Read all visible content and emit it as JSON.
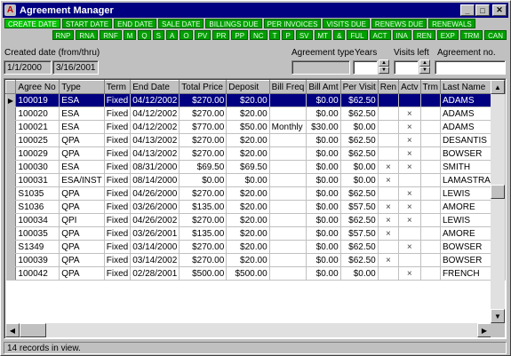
{
  "window": {
    "title": "Agreement Manager",
    "icon_letter": "A"
  },
  "title_buttons": {
    "minimize": "_",
    "maximize": "□",
    "close": "✕"
  },
  "nav_top": [
    "CREATE DATE",
    "START DATE",
    "END DATE",
    "SALE DATE",
    "BILLINGS DUE",
    "PER INVOICES",
    "VISITS DUE",
    "RENEWS DUE",
    "RENEWALS"
  ],
  "nav_bottom": [
    "RNP",
    "RNA",
    "RNF",
    "M",
    "Q",
    "S",
    "A",
    "O",
    "PV",
    "PR",
    "PP",
    "NC",
    "T",
    "P",
    "SV",
    "MT",
    "&",
    "FUL",
    "ACT",
    "INA",
    "REN",
    "EXP",
    "TRM",
    "CAN"
  ],
  "filters": {
    "created_label": "Created date (from/thru)",
    "from": "1/1/2000",
    "thru": "3/16/2001",
    "agreement_type_label": "Agreement type",
    "agreement_type_value": "",
    "years_label": "Years",
    "years_value": "",
    "visits_left_label": "Visits left",
    "visits_left_value": "",
    "agreement_no_label": "Agreement no.",
    "agreement_no_value": ""
  },
  "table": {
    "columns": [
      "Agree No",
      "Type",
      "Term",
      "End Date",
      "Total Price",
      "Deposit",
      "Bill Freq",
      "Bill Amt",
      "Per Visit",
      "Ren",
      "Actv",
      "Trm",
      "Last Name"
    ],
    "rows": [
      [
        "100019",
        "ESA",
        "Fixed",
        "04/12/2002",
        "$270.00",
        "$20.00",
        "",
        "$0.00",
        "$62.50",
        "",
        "",
        "",
        "ADAMS"
      ],
      [
        "100020",
        "ESA",
        "Fixed",
        "04/12/2002",
        "$270.00",
        "$20.00",
        "",
        "$0.00",
        "$62.50",
        "",
        "×",
        "",
        "ADAMS"
      ],
      [
        "100021",
        "ESA",
        "Fixed",
        "04/12/2002",
        "$770.00",
        "$50.00",
        "Monthly",
        "$30.00",
        "$0.00",
        "",
        "×",
        "",
        "ADAMS"
      ],
      [
        "100025",
        "QPA",
        "Fixed",
        "04/13/2002",
        "$270.00",
        "$20.00",
        "",
        "$0.00",
        "$62.50",
        "",
        "×",
        "",
        "DESANTIS"
      ],
      [
        "100029",
        "QPA",
        "Fixed",
        "04/13/2002",
        "$270.00",
        "$20.00",
        "",
        "$0.00",
        "$62.50",
        "",
        "×",
        "",
        "BOWSER"
      ],
      [
        "100030",
        "ESA",
        "Fixed",
        "08/31/2000",
        "$69.50",
        "$69.50",
        "",
        "$0.00",
        "$0.00",
        "×",
        "×",
        "",
        "SMITH"
      ],
      [
        "100031",
        "ESA/INST",
        "Fixed",
        "08/14/2000",
        "$0.00",
        "$0.00",
        "",
        "$0.00",
        "$0.00",
        "×",
        "",
        "",
        "LAMASTRA"
      ],
      [
        "S1035",
        "QPA",
        "Fixed",
        "04/26/2000",
        "$270.00",
        "$20.00",
        "",
        "$0.00",
        "$62.50",
        "",
        "×",
        "",
        "LEWIS"
      ],
      [
        "S1036",
        "QPA",
        "Fixed",
        "03/26/2000",
        "$135.00",
        "$20.00",
        "",
        "$0.00",
        "$57.50",
        "×",
        "×",
        "",
        "AMORE"
      ],
      [
        "100034",
        "QPI",
        "Fixed",
        "04/26/2002",
        "$270.00",
        "$20.00",
        "",
        "$0.00",
        "$62.50",
        "×",
        "×",
        "",
        "LEWIS"
      ],
      [
        "100035",
        "QPA",
        "Fixed",
        "03/26/2001",
        "$135.00",
        "$20.00",
        "",
        "$0.00",
        "$57.50",
        "×",
        "",
        "",
        "AMORE"
      ],
      [
        "S1349",
        "QPA",
        "Fixed",
        "03/14/2000",
        "$270.00",
        "$20.00",
        "",
        "$0.00",
        "$62.50",
        "",
        "×",
        "",
        "BOWSER"
      ],
      [
        "100039",
        "QPA",
        "Fixed",
        "03/14/2002",
        "$270.00",
        "$20.00",
        "",
        "$0.00",
        "$62.50",
        "×",
        "",
        "",
        "BOWSER"
      ],
      [
        "100042",
        "QPA",
        "Fixed",
        "02/28/2001",
        "$500.00",
        "$500.00",
        "",
        "$0.00",
        "$0.00",
        "",
        "×",
        "",
        "FRENCH"
      ]
    ]
  },
  "status": "14 records in view."
}
